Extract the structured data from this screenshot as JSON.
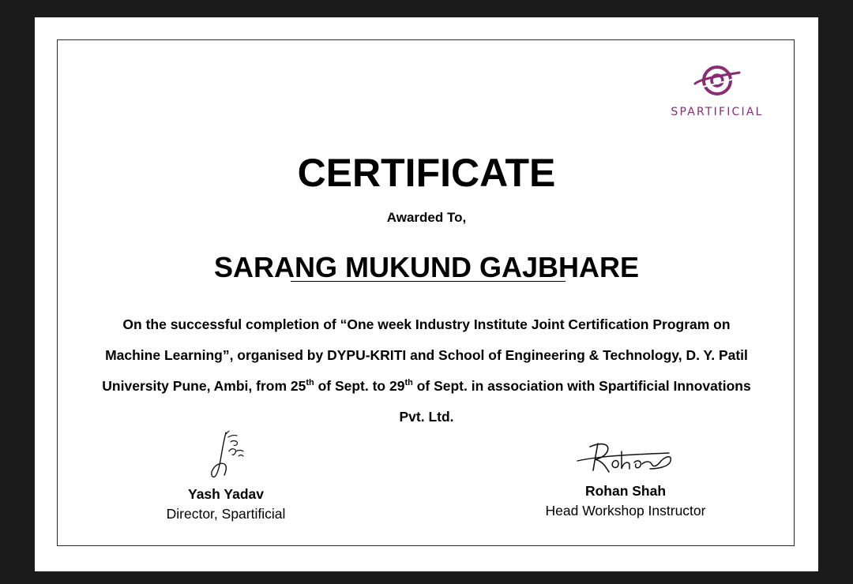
{
  "colors": {
    "background": "#1b1b1b",
    "sheet": "#ffffff",
    "border": "#2a2a2a",
    "brand": "#8a2c74",
    "text": "#000000"
  },
  "logo": {
    "icon": "spartificial-logo-icon",
    "text": "SPARTIFICIAL"
  },
  "certificate": {
    "title": "CERTIFICATE",
    "awarded_to": "Awarded To,",
    "recipient": "SARANG MUKUND GAJBHARE",
    "body": {
      "part1": "On the successful completion of “One week Industry Institute Joint Certification Program on Machine Learning”, organised by DYPU-KRITI and School of Engineering & Technology, D. Y. Patil University Pune, Ambi, from 25",
      "sup1": "th",
      "part2": " of Sept. to 29",
      "sup2": "th",
      "part3": " of Sept. in association with Spartificial Innovations Pvt. Ltd."
    }
  },
  "signatories": [
    {
      "signature": "Yash yadav",
      "name": "Yash Yadav",
      "role": "Director, Spartificial"
    },
    {
      "signature": "Rohan",
      "name": "Rohan Shah",
      "role": "Head Workshop Instructor"
    }
  ]
}
